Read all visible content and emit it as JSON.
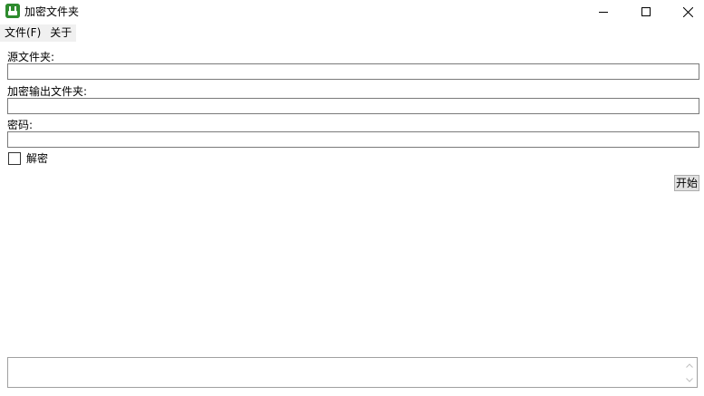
{
  "window": {
    "title": "加密文件夹",
    "icon": "android-app-icon",
    "controls": [
      "minimize-icon",
      "maximize-icon",
      "close-icon"
    ]
  },
  "menu": {
    "items": [
      {
        "label": "文件(F)"
      },
      {
        "label": "关于"
      }
    ]
  },
  "form": {
    "source_label": "源文件夹:",
    "source_value": "",
    "output_label": "加密输出文件夹:",
    "output_value": "",
    "password_label": "密码:",
    "password_value": "",
    "decrypt_label": "解密",
    "decrypt_checked": false,
    "start_label": "开始"
  },
  "log": {
    "value": ""
  },
  "colors": {
    "icon_green": "#2e8b2e",
    "menu_bg": "#f0f0f0",
    "button_bg": "#e1e1e1",
    "border": "#7a7a7a"
  }
}
